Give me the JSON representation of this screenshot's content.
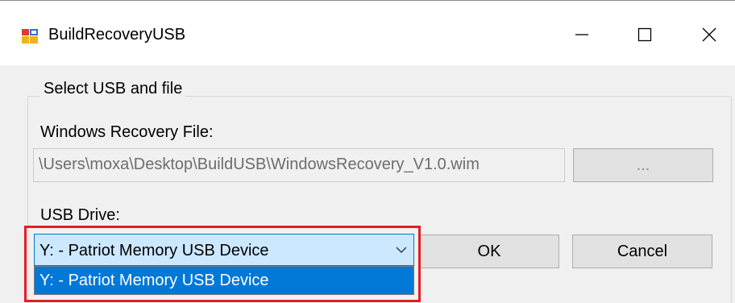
{
  "window": {
    "title": "BuildRecoveryUSB",
    "icon": "app-window-icon",
    "controls": [
      "minimize-icon",
      "maximize-icon",
      "close-icon"
    ]
  },
  "group": {
    "legend": "Select USB and file"
  },
  "recovery_file": {
    "label": "Windows Recovery File:",
    "value": "\\Users\\moxa\\Desktop\\BuildUSB\\WindowsRecovery_V1.0.wim",
    "browse_label": "..."
  },
  "usb_drive": {
    "label": "USB Drive:",
    "selected": "Y: - Patriot Memory USB Device",
    "options": [
      "Y: - Patriot Memory USB Device"
    ],
    "dropdown_open": true
  },
  "buttons": {
    "ok_label": "OK",
    "cancel_label": "Cancel"
  },
  "colors": {
    "highlight_border": "#e01f26",
    "selection": "#0078d7",
    "combo_focus_bg": "#cce8ff"
  }
}
